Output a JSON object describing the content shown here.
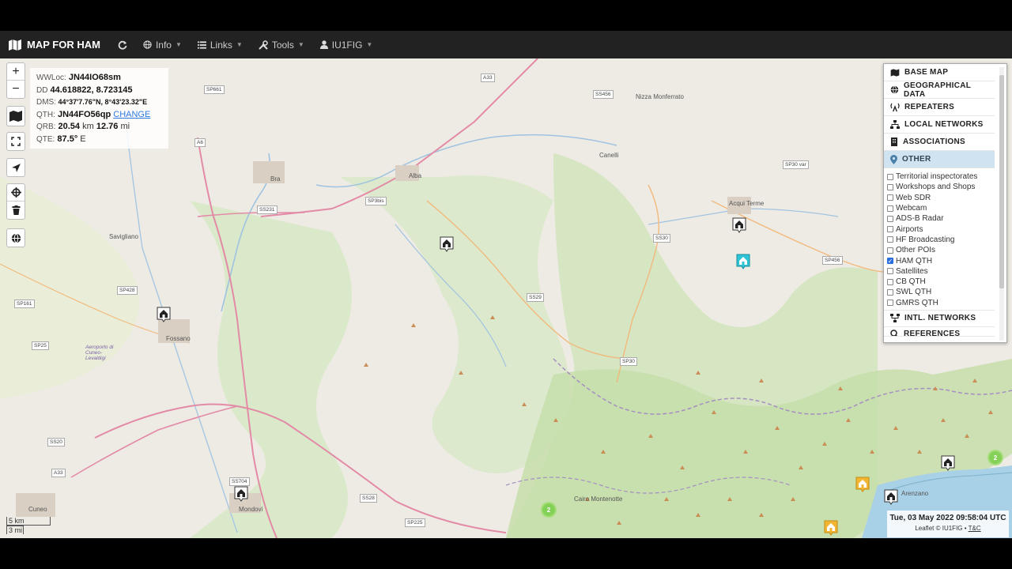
{
  "navbar": {
    "brand": "MAP FOR HAM",
    "items": [
      {
        "label": "Info"
      },
      {
        "label": "Links"
      },
      {
        "label": "Tools"
      },
      {
        "label": "IU1FIG"
      }
    ]
  },
  "zoom": {
    "in": "+",
    "out": "−"
  },
  "info": {
    "wwloc_key": "WWLoc:",
    "wwloc_val": "JN44IO68sm",
    "dd_key": "DD",
    "dd_val": "44.618822, 8.723145",
    "dms_key": "DMS:",
    "dms_val": "44°37'7.76\"N, 8°43'23.32\"E",
    "qth_key": "QTH:",
    "qth_val": "JN44FO56qp",
    "qth_change": "CHANGE",
    "qrb_key": "QRB:",
    "qrb_km": "20.54",
    "qrb_km_unit": "km",
    "qrb_mi": "12.76",
    "qrb_mi_unit": "mi",
    "qte_key": "QTE:",
    "qte_val": "87.5°",
    "qte_unit": "E"
  },
  "layers": {
    "headers": [
      {
        "label": "BASE MAP",
        "icon": "map-icon"
      },
      {
        "label": "GEOGRAPHICAL DATA",
        "icon": "globe-icon"
      },
      {
        "label": "REPEATERS",
        "icon": "antenna-icon"
      },
      {
        "label": "LOCAL NETWORKS",
        "icon": "network-icon"
      },
      {
        "label": "ASSOCIATIONS",
        "icon": "building-icon"
      },
      {
        "label": "OTHER",
        "icon": "pin-icon"
      }
    ],
    "other_items": [
      {
        "label": "Territorial inspectorates",
        "checked": false
      },
      {
        "label": "Workshops and Shops",
        "checked": false
      },
      {
        "label": "Web SDR",
        "checked": false
      },
      {
        "label": "Webcam",
        "checked": false
      },
      {
        "label": "ADS-B Radar",
        "checked": false
      },
      {
        "label": "Airports",
        "checked": false
      },
      {
        "label": "HF Broadcasting",
        "checked": false
      },
      {
        "label": "Other POIs",
        "checked": false
      },
      {
        "label": "HAM QTH",
        "checked": true
      },
      {
        "label": "Satellites",
        "checked": false
      },
      {
        "label": "CB QTH",
        "checked": false
      },
      {
        "label": "SWL QTH",
        "checked": false
      },
      {
        "label": "GMRS QTH",
        "checked": false
      }
    ],
    "intl_networks": "INTL. NETWORKS",
    "cut_label": "REFERENCES"
  },
  "status": {
    "datetime": "Tue, 03 May 2022 09:58:04 UTC",
    "leaflet": "Leaflet",
    "copyright": "© IU1FIG",
    "sep": "•",
    "tc": "T&C"
  },
  "scale": {
    "km": "5 km",
    "mi": "3 mi"
  },
  "places": [
    {
      "name": "Nizza Monferrato"
    },
    {
      "name": "Canelli"
    },
    {
      "name": "Acqui Terme"
    },
    {
      "name": "Alba"
    },
    {
      "name": "Bra"
    },
    {
      "name": "Savigliano"
    },
    {
      "name": "Fossano"
    },
    {
      "name": "Cuneo"
    },
    {
      "name": "Mondovì"
    },
    {
      "name": "Cairo Montenotte"
    },
    {
      "name": "Arenzano"
    },
    {
      "name": "Aeroporto di Cuneo-Levaldigi"
    }
  ],
  "roads": [
    "SP661",
    "A33",
    "A6",
    "SS231",
    "SP3bis",
    "SS456",
    "SP30 var",
    "SS30",
    "SP456",
    "SS29",
    "SP428",
    "SP161",
    "SP25",
    "SS20",
    "SP30",
    "SS704",
    "SS28",
    "SP225",
    "A33"
  ],
  "clusters": [
    {
      "count": "2"
    },
    {
      "count": "2"
    }
  ],
  "colors": {
    "navbar": "#222222",
    "active_layer": "#cfe3f0",
    "cluster": "#6ecc39",
    "checkbox_on": "#2a6fdb"
  }
}
